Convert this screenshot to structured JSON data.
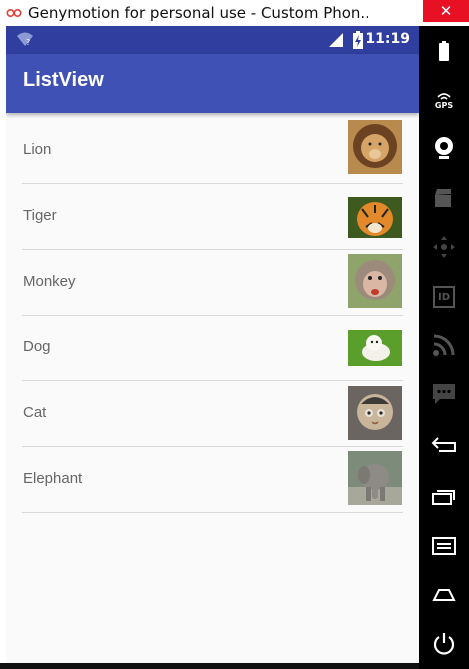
{
  "window": {
    "title": "Genymotion for personal use - Custom Phon...",
    "close_label": "✕"
  },
  "statusbar": {
    "time": "11:19"
  },
  "appbar": {
    "title": "ListView"
  },
  "list": {
    "items": [
      {
        "label": "Lion"
      },
      {
        "label": "Tiger"
      },
      {
        "label": "Monkey"
      },
      {
        "label": "Dog"
      },
      {
        "label": "Cat"
      },
      {
        "label": "Elephant"
      }
    ]
  },
  "sidepanel": {
    "gps_label": "GPS",
    "id_label": "ID",
    "icons": [
      "battery-icon",
      "gps-icon",
      "webcam-icon",
      "clapperboard-icon",
      "dpad-icon",
      "id-icon",
      "rss-icon",
      "sms-icon",
      "back-icon",
      "recent-apps-icon",
      "menu-icon",
      "home-icon",
      "power-icon"
    ]
  },
  "colors": {
    "status_bar": "#303f9f",
    "app_bar": "#3f51b5",
    "close_button": "#e81123"
  }
}
